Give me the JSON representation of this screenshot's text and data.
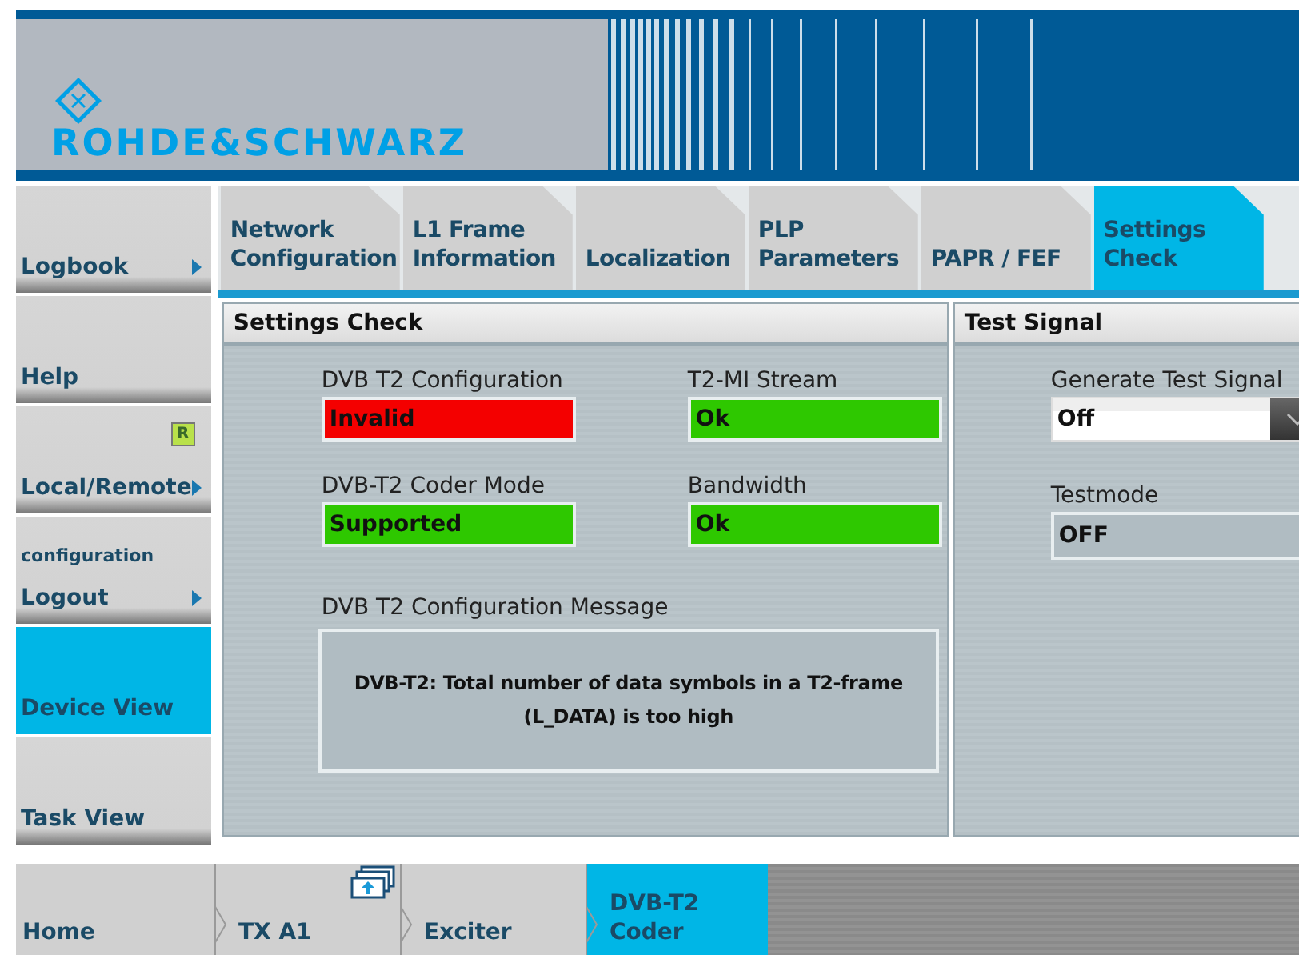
{
  "header": {
    "brand": "ROHDE&SCHWARZ"
  },
  "sidebar": {
    "items": [
      {
        "label": "Logbook",
        "arrow": true,
        "selected": false
      },
      {
        "label": "Help",
        "arrow": false,
        "selected": false
      },
      {
        "label": "Local/Remote",
        "badge": "R",
        "arrow": true,
        "selected": false
      },
      {
        "label": "Logout",
        "caption": "configuration",
        "arrow": true,
        "selected": false
      },
      {
        "label": "Device View",
        "arrow": false,
        "selected": true
      },
      {
        "label": "Task View",
        "arrow": false,
        "selected": false
      }
    ]
  },
  "tabs": [
    {
      "label": "Network Configuration",
      "selected": false
    },
    {
      "label": "L1 Frame Information",
      "selected": false
    },
    {
      "label": "Localization",
      "selected": false
    },
    {
      "label": "PLP Parameters",
      "selected": false
    },
    {
      "label": "PAPR / FEF",
      "selected": false
    },
    {
      "label": "Settings Check",
      "selected": true
    }
  ],
  "settings_check": {
    "title": "Settings Check",
    "statuses": [
      {
        "label": "DVB T2 Configuration",
        "value": "Invalid",
        "color": "#f40000"
      },
      {
        "label": "T2-MI Stream",
        "value": "Ok",
        "color": "#2ec800"
      },
      {
        "label": "DVB-T2 Coder Mode",
        "value": "Supported",
        "color": "#2ec800"
      },
      {
        "label": "Bandwidth",
        "value": "Ok",
        "color": "#2ec800"
      }
    ],
    "message_label": "DVB T2 Configuration Message",
    "message": "DVB-T2: Total number of data symbols in a T2-frame (L_DATA) is too high"
  },
  "test_signal": {
    "title": "Test Signal",
    "generate_label": "Generate Test Signal",
    "generate_value": "Off",
    "testmode_label": "Testmode",
    "testmode_value": "OFF"
  },
  "breadcrumb": [
    {
      "label": "Home",
      "icon": false,
      "selected": false
    },
    {
      "label": "TX A1",
      "icon": true,
      "selected": false
    },
    {
      "label": "Exciter",
      "icon": false,
      "selected": false
    },
    {
      "label": "DVB-T2 Coder",
      "icon": false,
      "selected": true
    }
  ]
}
